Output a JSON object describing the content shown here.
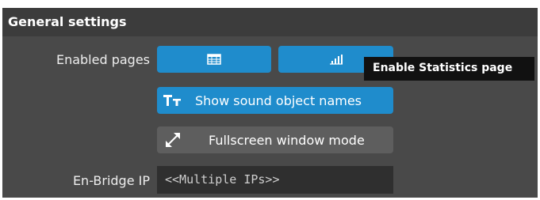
{
  "section": {
    "title": "General settings"
  },
  "enabled_pages": {
    "label": "Enabled pages",
    "buttons": [
      {
        "icon": "table-icon",
        "active": true
      },
      {
        "icon": "statistics-bar-chart-icon",
        "active": true
      }
    ]
  },
  "sound_names_button": {
    "label": "Show sound object names",
    "icon": "text-size-icon",
    "active": true
  },
  "fullscreen_button": {
    "label": "Fullscreen window mode",
    "icon": "expand-diagonal-icon",
    "active": false
  },
  "en_bridge": {
    "label": "En-Bridge IP",
    "value": "<<Multiple IPs>>"
  },
  "tooltip": {
    "text": "Enable Statistics page"
  },
  "colors": {
    "accent": "#1f8ccc",
    "panel": "#494949",
    "header": "#3c3c3c",
    "inactive_button": "#5e5e5e",
    "field": "#2f2f2f",
    "tooltip": "#111111"
  }
}
